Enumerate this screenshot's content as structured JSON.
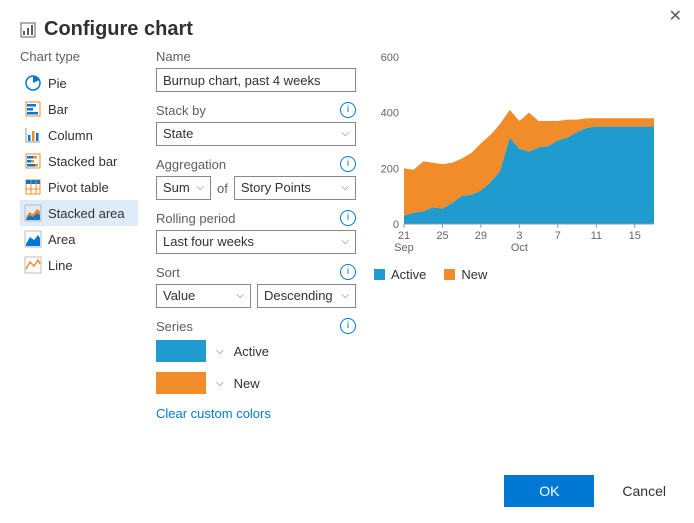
{
  "title": "Configure chart",
  "close_tooltip": "Close",
  "sections": {
    "chart_type": "Chart type",
    "name": "Name",
    "stack_by": "Stack by",
    "aggregation": "Aggregation",
    "rolling": "Rolling period",
    "sort": "Sort",
    "series": "Series"
  },
  "chart_types": [
    {
      "id": "pie",
      "label": "Pie"
    },
    {
      "id": "bar",
      "label": "Bar"
    },
    {
      "id": "column",
      "label": "Column"
    },
    {
      "id": "stacked-bar",
      "label": "Stacked bar"
    },
    {
      "id": "pivot",
      "label": "Pivot table"
    },
    {
      "id": "stacked-area",
      "label": "Stacked area",
      "selected": true
    },
    {
      "id": "area",
      "label": "Area"
    },
    {
      "id": "line",
      "label": "Line"
    }
  ],
  "form": {
    "name_value": "Burnup chart, past 4 weeks",
    "stack_by_value": "State",
    "agg_func": "Sum",
    "agg_of": "of",
    "agg_field": "Story Points",
    "rolling_value": "Last four weeks",
    "sort_field": "Value",
    "sort_dir": "Descending"
  },
  "series": [
    {
      "color": "#1f9bcf",
      "label": "Active"
    },
    {
      "color": "#f08c29",
      "label": "New"
    }
  ],
  "clear_colors": "Clear custom colors",
  "legend": [
    {
      "label": "Active",
      "color": "#1f9bcf"
    },
    {
      "label": "New",
      "color": "#f08c29"
    }
  ],
  "buttons": {
    "ok": "OK",
    "cancel": "Cancel"
  },
  "colors": {
    "active": "#1f9bcf",
    "new": "#f08c29"
  },
  "chart_data": {
    "type": "area",
    "stacked": true,
    "ylim": [
      0,
      600
    ],
    "y_ticks": [
      0,
      200,
      400,
      600
    ],
    "x_labels": [
      "21",
      "25",
      "29",
      "3",
      "7",
      "11",
      "15"
    ],
    "x_month_labels": [
      "Sep",
      "Oct"
    ],
    "x_month_positions": [
      0,
      3
    ],
    "series": [
      {
        "name": "Active",
        "color": "#1f9bcf",
        "values": [
          30,
          40,
          45,
          60,
          55,
          75,
          100,
          105,
          120,
          150,
          190,
          310,
          270,
          260,
          275,
          280,
          300,
          310,
          330,
          345,
          350,
          350,
          350,
          350,
          350,
          350,
          350
        ]
      },
      {
        "name": "New",
        "color": "#f08c29",
        "values": [
          200,
          195,
          225,
          220,
          215,
          220,
          235,
          255,
          290,
          320,
          360,
          410,
          370,
          400,
          370,
          370,
          370,
          375,
          375,
          380,
          380,
          380,
          380,
          380,
          380,
          380,
          380
        ]
      }
    ]
  }
}
